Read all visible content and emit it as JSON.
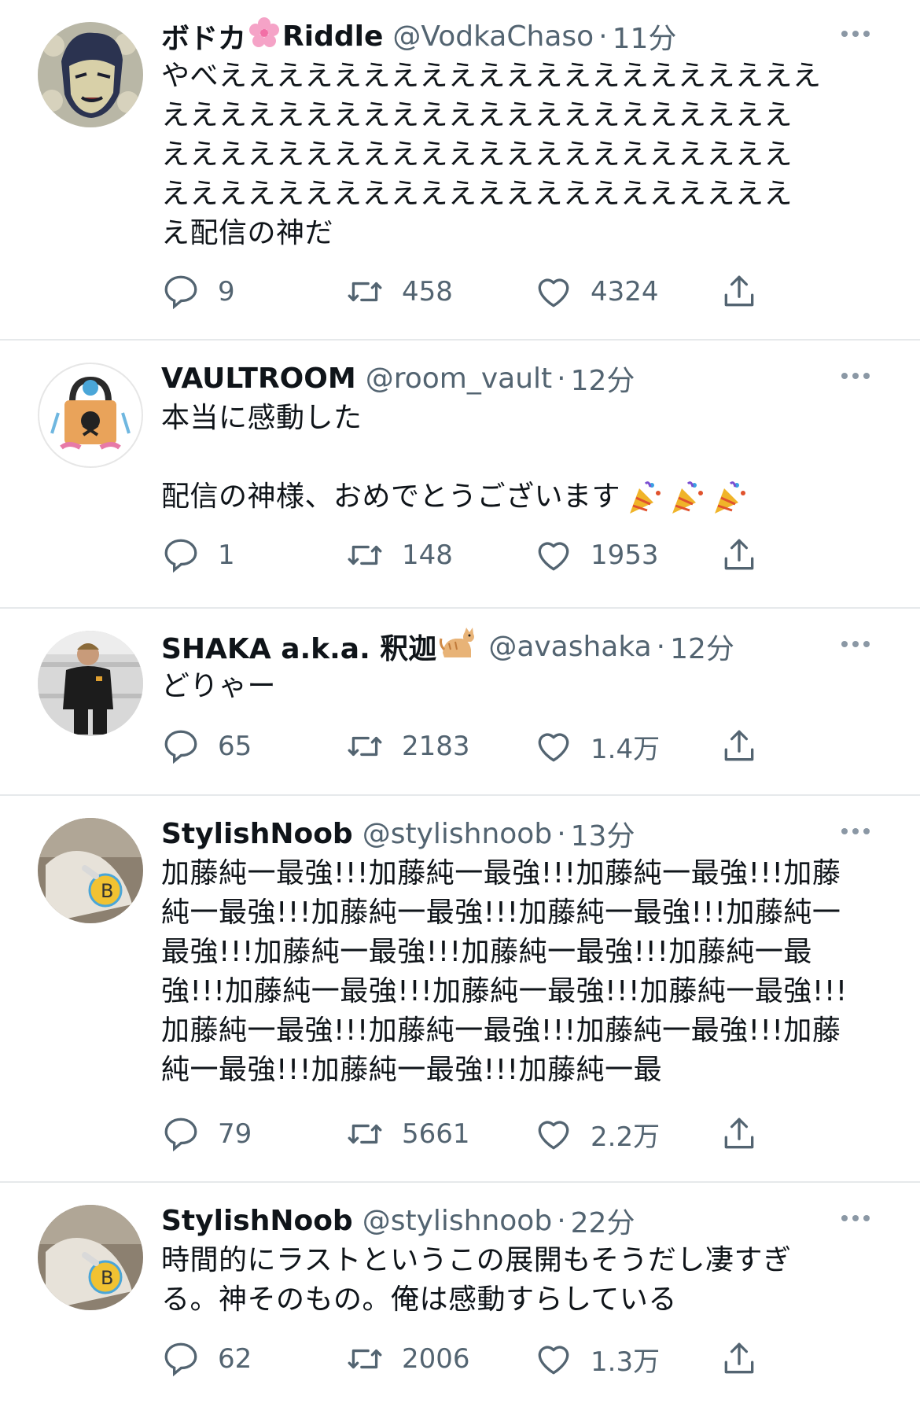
{
  "tweets": [
    {
      "name": "ボドカ",
      "name_suffix": "Riddle",
      "name_emoji": "cherry-blossom-icon",
      "handle": "@VodkaChaso",
      "dot": "·",
      "time": "11分",
      "text": "やべえええええええええええええええええええええ\nええええええええええええええええええええええ\nええええええええええええええええええええええ\nええええええええええええええええええええええ\nえ配信の神だ",
      "replies": "9",
      "retweets": "458",
      "likes": "4324"
    },
    {
      "name": "VAULTROOM",
      "handle": "@room_vault",
      "dot": "·",
      "time": "12分",
      "text": "本当に感動した\n\n配信の神様、おめでとうございます",
      "text_emoji": [
        "party-popper-icon",
        "party-popper-icon",
        "party-popper-icon"
      ],
      "replies": "1",
      "retweets": "148",
      "likes": "1953"
    },
    {
      "name": "SHAKA a.k.a. 釈迦",
      "name_emoji": "cat-icon",
      "handle": "@avashaka",
      "dot": "·",
      "time": "12分",
      "text": "どりゃー",
      "replies": "65",
      "retweets": "2183",
      "likes": "1.4万"
    },
    {
      "name": "StylishNoob",
      "handle": "@stylishnoob",
      "dot": "·",
      "time": "13分",
      "text": "加藤純一最強!!!加藤純一最強!!!加藤純一最強!!!加藤\n純一最強!!!加藤純一最強!!!加藤純一最強!!!加藤純一\n最強!!!加藤純一最強!!!加藤純一最強!!!加藤純一最\n強!!!加藤純一最強!!!加藤純一最強!!!加藤純一最強!!!\n加藤純一最強!!!加藤純一最強!!!加藤純一最強!!!加藤\n純一最強!!!加藤純一最強!!!加藤純一最",
      "replies": "79",
      "retweets": "5661",
      "likes": "2.2万"
    },
    {
      "name": "StylishNoob",
      "handle": "@stylishnoob",
      "dot": "·",
      "time": "22分",
      "text": "時間的にラストというこの展開もそうだし凄すぎ\nる。神そのもの。俺は感動すらしている",
      "replies": "62",
      "retweets": "2006",
      "likes": "1.3万"
    }
  ],
  "colors": {
    "secondary_text": "#536471",
    "primary_text": "#0f1419",
    "divider": "#e6e9eb",
    "icon_gray": "#536471"
  }
}
